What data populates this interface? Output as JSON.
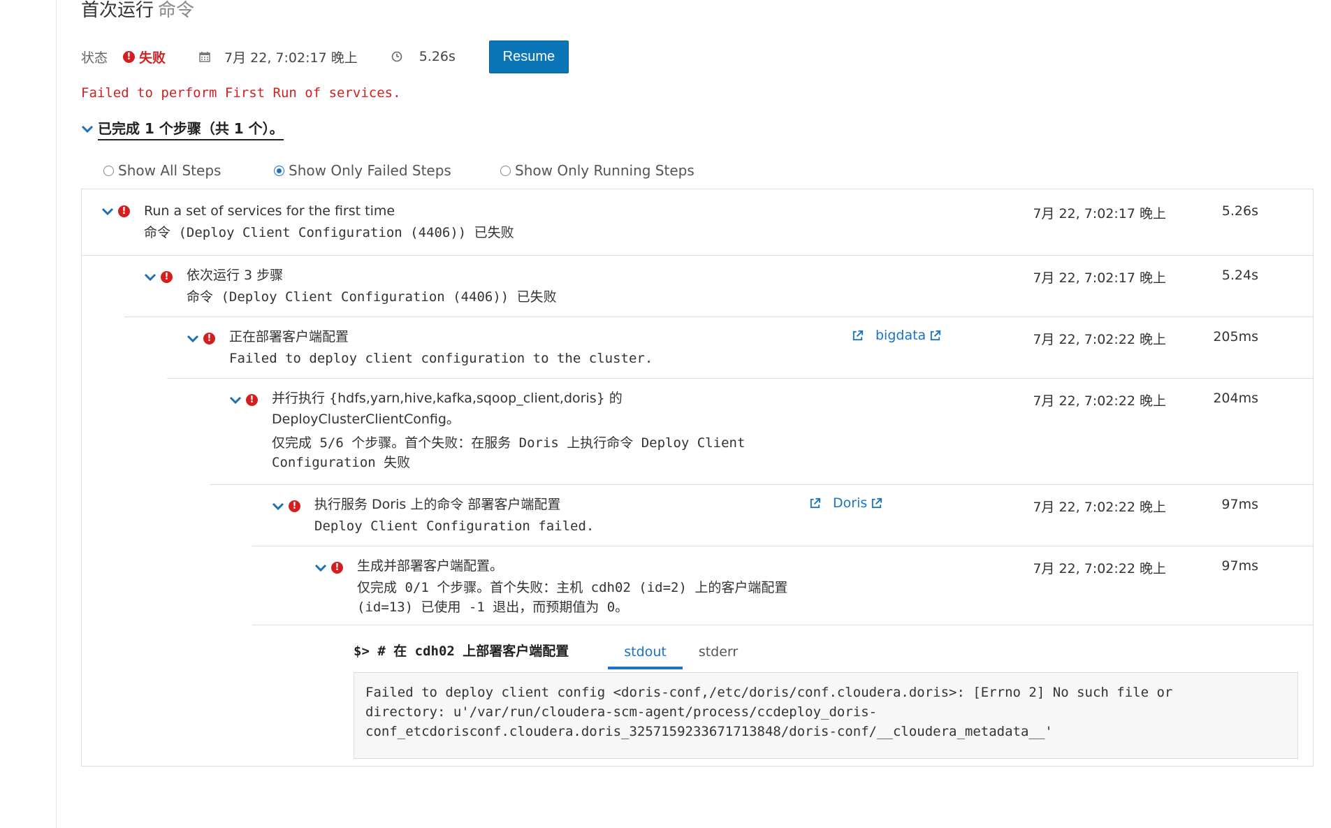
{
  "header": {
    "title": "首次运行",
    "title_sub": "命令"
  },
  "status": {
    "label": "状态",
    "state": "失败",
    "start_time": "7月 22, 7:02:17 晚上",
    "duration": "5.26s",
    "resume_label": "Resume"
  },
  "error_message": "Failed to perform First Run of services.",
  "summary": "已完成 1 个步骤（共 1 个）。",
  "filters": [
    {
      "label": "Show All Steps",
      "selected": false
    },
    {
      "label": "Show Only Failed Steps",
      "selected": true
    },
    {
      "label": "Show Only Running Steps",
      "selected": false
    }
  ],
  "steps": [
    {
      "title": "Run a set of services for the first time",
      "desc": [
        "命令 (Deploy Client Configuration (4406)) 已失败"
      ],
      "time": "7月 22, 7:02:17 晚上",
      "duration": "5.26s"
    },
    {
      "title": "依次运行 3 步骤",
      "desc": [
        "命令 (Deploy Client Configuration (4406)) 已失败"
      ],
      "time": "7月 22, 7:02:17 晚上",
      "duration": "5.24s"
    },
    {
      "title": "正在部署客户端配置",
      "desc": [
        "Failed to deploy client configuration to the cluster."
      ],
      "link": "bigdata",
      "time": "7月 22, 7:02:22 晚上",
      "duration": "205ms"
    },
    {
      "title": "并行执行 {hdfs,yarn,hive,kafka,sqoop_client,doris} 的",
      "title2": "DeployClusterClientConfig。",
      "desc": [
        "仅完成 5/6 个步骤。首个失败：在服务 Doris 上执行命令 Deploy Client",
        "Configuration 失败"
      ],
      "time": "7月 22, 7:02:22 晚上",
      "duration": "204ms"
    },
    {
      "title": "执行服务 Doris 上的命令 部署客户端配置",
      "desc": [
        "Deploy Client Configuration failed."
      ],
      "link": "Doris",
      "time": "7月 22, 7:02:22 晚上",
      "duration": "97ms"
    },
    {
      "title": "生成并部署客户端配置。",
      "desc": [
        "仅完成 0/1 个步骤。首个失败：主机 cdh02 (id=2) 上的客户端配置",
        "(id=13) 已使用 -1 退出，而预期值为 0。"
      ],
      "time": "7月 22, 7:02:22 晚上",
      "duration": "97ms"
    }
  ],
  "log": {
    "command": "$> # 在 cdh02 上部署客户端配置",
    "tabs": [
      "stdout",
      "stderr"
    ],
    "active_tab": "stdout",
    "lines": [
      "Failed to deploy client config <doris-conf,/etc/doris/conf.cloudera.doris>: [Errno 2] No such file or",
      "directory: u'/var/run/cloudera-scm-agent/process/ccdeploy_doris-",
      "conf_etcdorisconf.cloudera.doris_3257159233671713848/doris-conf/__cloudera_metadata__'"
    ]
  },
  "colors": {
    "error": "#d31f1f",
    "accent": "#1a73c7",
    "button": "#0a76b7",
    "chevron": "#1f6fb5"
  }
}
